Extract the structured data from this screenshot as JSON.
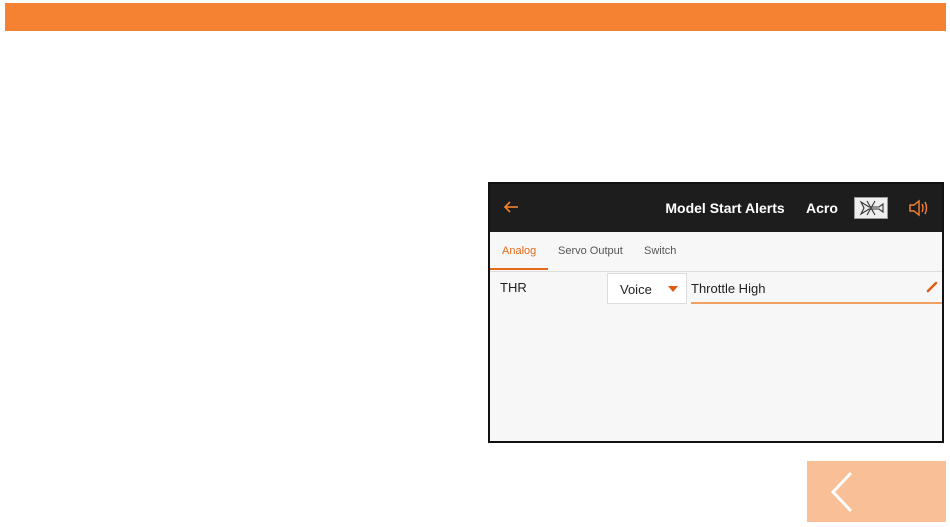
{
  "screen": {
    "title": "Model Start Alerts",
    "model_name": "Acro",
    "model_type_icon": "airplane-icon",
    "tabs": [
      {
        "label": "Analog",
        "active": true
      },
      {
        "label": "Servo Output",
        "active": false
      },
      {
        "label": "Switch",
        "active": false
      }
    ],
    "alerts": [
      {
        "channel": "THR",
        "type": "Voice",
        "text": "Throttle High"
      }
    ]
  },
  "colors": {
    "accent": "#f58232",
    "header_bg": "#1d1d1d",
    "active_tab": "#e36a1b",
    "back_button": "#f9bf96"
  },
  "icons": {
    "back": "back-arrow-icon",
    "speaker": "speaker-icon",
    "edit": "pencil-icon",
    "page_back": "chevron-left-icon"
  }
}
